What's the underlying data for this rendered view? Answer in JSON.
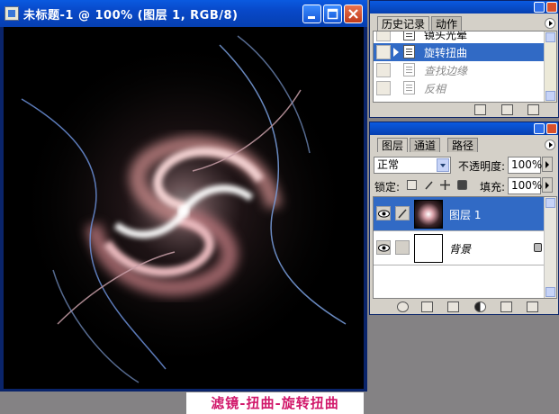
{
  "document": {
    "title": "未标题-1 @ 100% (图层 1, RGB/8)",
    "watermark": "滤镜-扭曲-旋转扭曲"
  },
  "history_panel": {
    "tabs": [
      "历史记录",
      "动作"
    ],
    "items": [
      {
        "label": "镜头光晕",
        "state": "normal"
      },
      {
        "label": "旋转扭曲",
        "state": "selected"
      },
      {
        "label": "查找边缘",
        "state": "undone"
      },
      {
        "label": "反相",
        "state": "undone"
      }
    ],
    "toolbar_icons": [
      "new-document-from-state-icon",
      "snapshot-icon",
      "trash-icon"
    ]
  },
  "layers_panel": {
    "tabs": [
      "图层",
      "通道",
      "路径"
    ],
    "blend_mode": "正常",
    "opacity_label": "不透明度:",
    "opacity_value": "100%",
    "lock_label": "锁定:",
    "fill_label": "填充:",
    "fill_value": "100%",
    "layers": [
      {
        "name": "图层 1",
        "selected": true,
        "visible": true,
        "thumb": "swirl"
      },
      {
        "name": "背景",
        "selected": false,
        "visible": true,
        "thumb": "white",
        "locked": true
      }
    ],
    "bottom_icons": [
      "link-layers-icon",
      "layer-style-icon",
      "layer-mask-icon",
      "new-group-icon",
      "adjustment-layer-icon",
      "new-layer-icon",
      "trash-icon"
    ]
  },
  "colors": {
    "titlebar": "#0848c8",
    "selection": "#316ac5",
    "panel_bg": "#d4d0c8",
    "watermark_text": "#d1176a"
  }
}
